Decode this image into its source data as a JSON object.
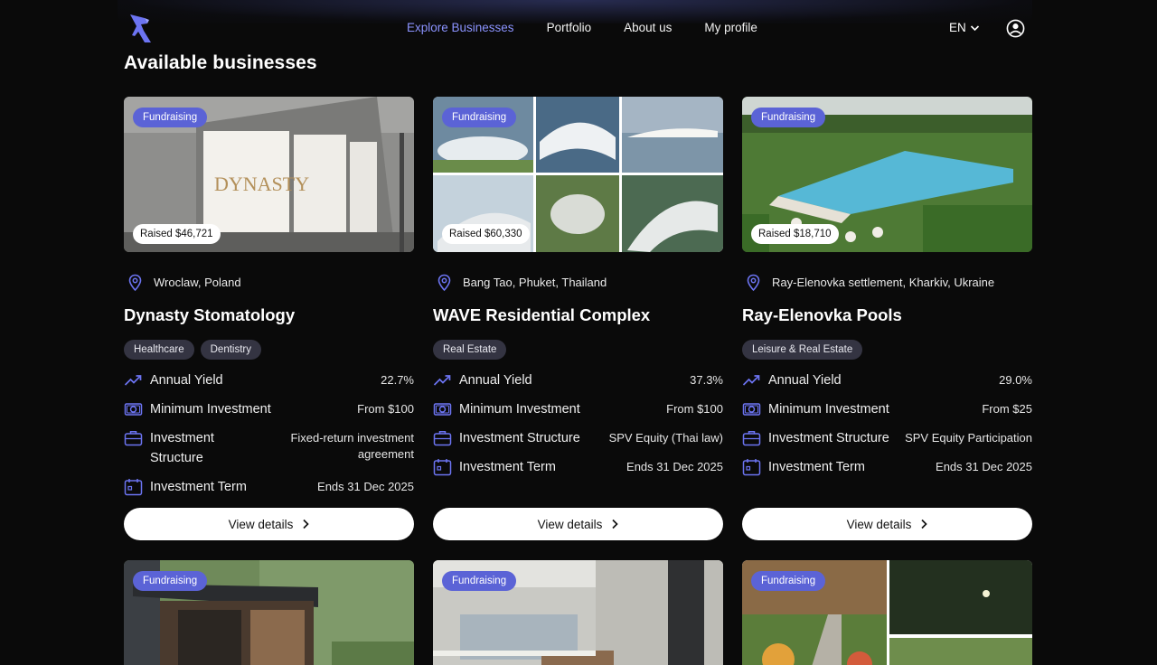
{
  "nav": {
    "links": [
      "Explore Businesses",
      "Portfolio",
      "About us",
      "My profile"
    ],
    "active_index": 0,
    "language": "EN",
    "logo_icon": "hawk-logo-icon",
    "profile_icon": "user-circle-icon"
  },
  "page": {
    "title": "Available businesses"
  },
  "colors": {
    "accent": "#8b93ff",
    "badge": "#5b63d6",
    "background": "#0a0a0a",
    "tag": "#343442"
  },
  "labels": {
    "annual_yield": "Annual Yield",
    "minimum_investment": "Minimum Investment",
    "investment_structure": "Investment Structure",
    "investment_term": "Investment Term",
    "view_details": "View details",
    "fundraising": "Fundraising"
  },
  "businesses": [
    {
      "status": "Fundraising",
      "raised": "Raised $46,721",
      "location": "Wroclaw, Poland",
      "name": "Dynasty Stomatology",
      "tags": [
        "Healthcare",
        "Dentistry"
      ],
      "annual_yield": "22.7%",
      "minimum_investment": "From $100",
      "investment_structure": "Fixed-return investment agreement",
      "investment_term": "Ends 31 Dec 2025",
      "image_text": "DYNASTY"
    },
    {
      "status": "Fundraising",
      "raised": "Raised $60,330",
      "location": "Bang Tao, Phuket, Thailand",
      "name": "WAVE Residential Complex",
      "tags": [
        "Real Estate"
      ],
      "annual_yield": "37.3%",
      "minimum_investment": "From $100",
      "investment_structure": "SPV Equity (Thai law)",
      "investment_term": "Ends 31 Dec 2025"
    },
    {
      "status": "Fundraising",
      "raised": "Raised $18,710",
      "location": "Ray-Elenovka settlement, Kharkiv, Ukraine",
      "name": "Ray-Elenovka Pools",
      "tags": [
        "Leisure & Real Estate"
      ],
      "annual_yield": "29.0%",
      "minimum_investment": "From $25",
      "investment_structure": "SPV Equity Participation",
      "investment_term": "Ends 31 Dec 2025"
    }
  ],
  "next_row": [
    {
      "status": "Fundraising"
    },
    {
      "status": "Fundraising"
    },
    {
      "status": "Fundraising"
    }
  ]
}
